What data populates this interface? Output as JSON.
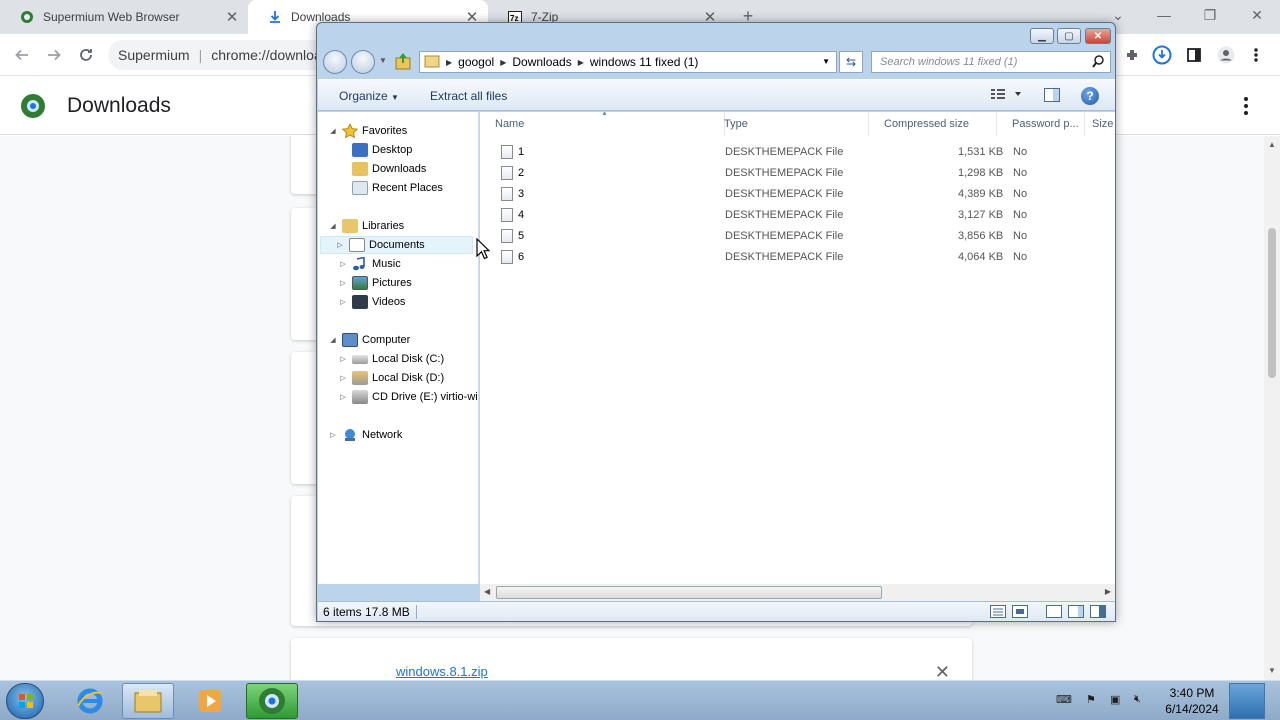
{
  "browser": {
    "tabs": [
      {
        "label": "Supermium Web Browser",
        "active": false
      },
      {
        "label": "Downloads",
        "active": true
      },
      {
        "label": "7-Zip",
        "active": false
      }
    ],
    "omnibox": {
      "site": "Supermium",
      "url": "chrome://downloads"
    },
    "page_title": "Downloads",
    "download_item": {
      "filename": "windows.8.1.zip"
    }
  },
  "explorer": {
    "breadcrumbs": [
      "googol",
      "Downloads",
      "windows 11 fixed (1)"
    ],
    "search_placeholder": "Search windows 11 fixed (1)",
    "toolbar": {
      "organize": "Organize",
      "extract": "Extract all files"
    },
    "nav": {
      "favorites": "Favorites",
      "desktop": "Desktop",
      "downloads": "Downloads",
      "recent": "Recent Places",
      "libraries": "Libraries",
      "documents": "Documents",
      "music": "Music",
      "pictures": "Pictures",
      "videos": "Videos",
      "computer": "Computer",
      "disk_c": "Local Disk (C:)",
      "disk_d": "Local Disk (D:)",
      "cd_drive": "CD Drive (E:) virtio-win",
      "network": "Network"
    },
    "columns": {
      "name": "Name",
      "type": "Type",
      "compressed": "Compressed size",
      "password": "Password p...",
      "size": "Size"
    },
    "files": [
      {
        "name": "1",
        "type": "DESKTHEMEPACK File",
        "compressed": "1,531 KB",
        "password": "No"
      },
      {
        "name": "2",
        "type": "DESKTHEMEPACK File",
        "compressed": "1,298 KB",
        "password": "No"
      },
      {
        "name": "3",
        "type": "DESKTHEMEPACK File",
        "compressed": "4,389 KB",
        "password": "No"
      },
      {
        "name": "4",
        "type": "DESKTHEMEPACK File",
        "compressed": "3,127 KB",
        "password": "No"
      },
      {
        "name": "5",
        "type": "DESKTHEMEPACK File",
        "compressed": "3,856 KB",
        "password": "No"
      },
      {
        "name": "6",
        "type": "DESKTHEMEPACK File",
        "compressed": "4,064 KB",
        "password": "No"
      }
    ],
    "status": "6 items  17.8 MB"
  },
  "taskbar": {
    "time": "3:40 PM",
    "date": "6/14/2024"
  }
}
